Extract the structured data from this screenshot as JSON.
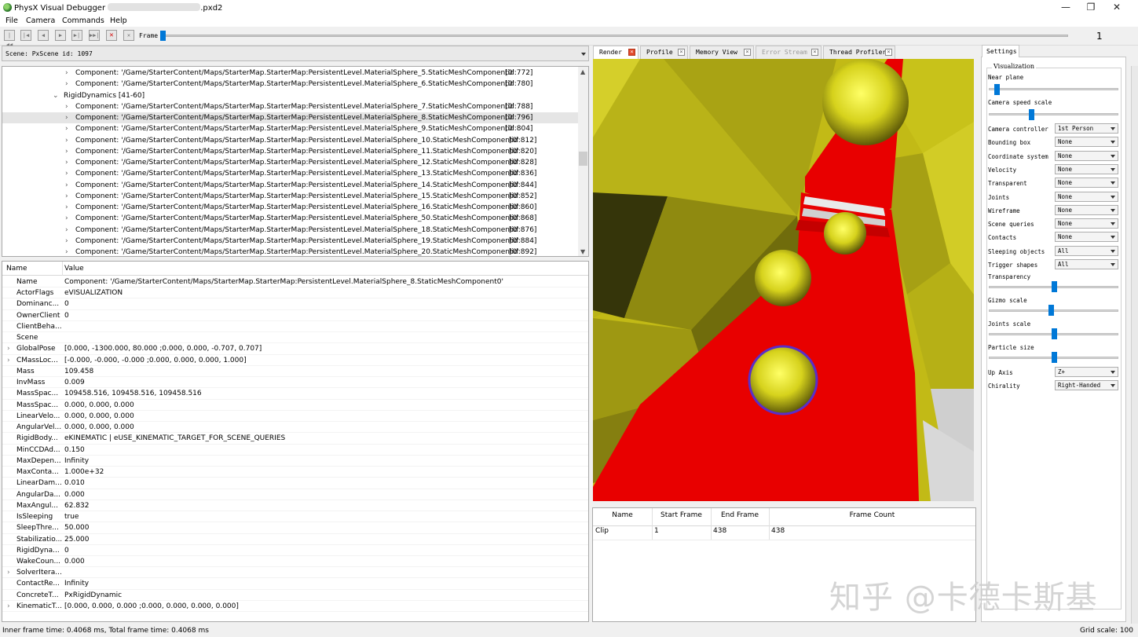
{
  "window": {
    "title_prefix": "PhysX Visual Debugger",
    "title_suffix": ".pxd2",
    "minimize_icon": "minimize-icon",
    "maximize_icon": "maximize-icon",
    "close_icon": "close-icon"
  },
  "menu": [
    "File",
    "Camera",
    "Commands",
    "Help"
  ],
  "toolbar": {
    "buttons": [
      "go-to-first-frame-icon",
      "step-back-icon",
      "play-backward-icon",
      "play-forward-icon",
      "step-forward-icon",
      "go-to-last-frame-icon",
      "stop-icon",
      "disconnect-icon"
    ],
    "frame_label": "Frame",
    "frame_value": "1"
  },
  "scene": {
    "label": "Scene: PxScene id: 1097"
  },
  "tree": {
    "group_label": "RigidDynamics [41-60]",
    "rows": [
      {
        "text": "Component: '/Game/StarterContent/Maps/StarterMap.StarterMap:PersistentLevel.MaterialSphere_5.StaticMeshComponent0'",
        "id": "[id:772]"
      },
      {
        "text": "Component: '/Game/StarterContent/Maps/StarterMap.StarterMap:PersistentLevel.MaterialSphere_6.StaticMeshComponent0'",
        "id": "[id:780]"
      },
      {
        "text": "Component: '/Game/StarterContent/Maps/StarterMap.StarterMap:PersistentLevel.MaterialSphere_7.StaticMeshComponent0'",
        "id": "[id:788]"
      },
      {
        "text": "Component: '/Game/StarterContent/Maps/StarterMap.StarterMap:PersistentLevel.MaterialSphere_8.StaticMeshComponent0'",
        "id": "[id:796]"
      },
      {
        "text": "Component: '/Game/StarterContent/Maps/StarterMap.StarterMap:PersistentLevel.MaterialSphere_9.StaticMeshComponent0'",
        "id": "[id:804]"
      },
      {
        "text": "Component: '/Game/StarterContent/Maps/StarterMap.StarterMap:PersistentLevel.MaterialSphere_10.StaticMeshComponent0'",
        "id": "[id:812]"
      },
      {
        "text": "Component: '/Game/StarterContent/Maps/StarterMap.StarterMap:PersistentLevel.MaterialSphere_11.StaticMeshComponent0'",
        "id": "[id:820]"
      },
      {
        "text": "Component: '/Game/StarterContent/Maps/StarterMap.StarterMap:PersistentLevel.MaterialSphere_12.StaticMeshComponent0'",
        "id": "[id:828]"
      },
      {
        "text": "Component: '/Game/StarterContent/Maps/StarterMap.StarterMap:PersistentLevel.MaterialSphere_13.StaticMeshComponent0'",
        "id": "[id:836]"
      },
      {
        "text": "Component: '/Game/StarterContent/Maps/StarterMap.StarterMap:PersistentLevel.MaterialSphere_14.StaticMeshComponent0'",
        "id": "[id:844]"
      },
      {
        "text": "Component: '/Game/StarterContent/Maps/StarterMap.StarterMap:PersistentLevel.MaterialSphere_15.StaticMeshComponent0'",
        "id": "[id:852]"
      },
      {
        "text": "Component: '/Game/StarterContent/Maps/StarterMap.StarterMap:PersistentLevel.MaterialSphere_16.StaticMeshComponent0'",
        "id": "[id:860]"
      },
      {
        "text": "Component: '/Game/StarterContent/Maps/StarterMap.StarterMap:PersistentLevel.MaterialSphere_50.StaticMeshComponent0'",
        "id": "[id:868]"
      },
      {
        "text": "Component: '/Game/StarterContent/Maps/StarterMap.StarterMap:PersistentLevel.MaterialSphere_18.StaticMeshComponent0'",
        "id": "[id:876]"
      },
      {
        "text": "Component: '/Game/StarterContent/Maps/StarterMap.StarterMap:PersistentLevel.MaterialSphere_19.StaticMeshComponent0'",
        "id": "[id:884]"
      },
      {
        "text": "Component: '/Game/StarterContent/Maps/StarterMap.StarterMap:PersistentLevel.MaterialSphere_20.StaticMeshComponent0'",
        "id": "[id:892]"
      }
    ]
  },
  "properties": {
    "header_name": "Name",
    "header_value": "Value",
    "rows": [
      {
        "name": "Name",
        "value": "Component: '/Game/StarterContent/Maps/StarterMap.StarterMap:PersistentLevel.MaterialSphere_8.StaticMeshComponent0'",
        "expandable": false
      },
      {
        "name": "ActorFlags",
        "value": "eVISUALIZATION",
        "expandable": false
      },
      {
        "name": "Dominanc...",
        "value": "0",
        "expandable": false
      },
      {
        "name": "OwnerClient",
        "value": "0",
        "expandable": false
      },
      {
        "name": "ClientBeha...",
        "value": "",
        "expandable": false
      },
      {
        "name": "Scene",
        "value": "",
        "expandable": false
      },
      {
        "name": "GlobalPose",
        "value": "[0.000, -1300.000, 80.000 ;0.000, 0.000, -0.707, 0.707]",
        "expandable": true
      },
      {
        "name": "CMassLoc...",
        "value": "[-0.000, -0.000, -0.000 ;0.000, 0.000, 0.000, 1.000]",
        "expandable": true
      },
      {
        "name": "Mass",
        "value": "109.458",
        "expandable": false
      },
      {
        "name": "InvMass",
        "value": "0.009",
        "expandable": false
      },
      {
        "name": "MassSpac...",
        "value": "109458.516, 109458.516, 109458.516",
        "expandable": false
      },
      {
        "name": "MassSpac...",
        "value": "0.000, 0.000, 0.000",
        "expandable": false
      },
      {
        "name": "LinearVelo...",
        "value": "0.000, 0.000, 0.000",
        "expandable": false
      },
      {
        "name": "AngularVel...",
        "value": "0.000, 0.000, 0.000",
        "expandable": false
      },
      {
        "name": "RigidBody...",
        "value": "eKINEMATIC | eUSE_KINEMATIC_TARGET_FOR_SCENE_QUERIES",
        "expandable": false
      },
      {
        "name": "MinCCDAd...",
        "value": "0.150",
        "expandable": false
      },
      {
        "name": "MaxDepen...",
        "value": "Infinity",
        "expandable": false
      },
      {
        "name": "MaxConta...",
        "value": "1.000e+32",
        "expandable": false
      },
      {
        "name": "LinearDam...",
        "value": "0.010",
        "expandable": false
      },
      {
        "name": "AngularDa...",
        "value": "0.000",
        "expandable": false
      },
      {
        "name": "MaxAngul...",
        "value": "62.832",
        "expandable": false
      },
      {
        "name": "IsSleeping",
        "value": "true",
        "expandable": false
      },
      {
        "name": "SleepThre...",
        "value": "50.000",
        "expandable": false
      },
      {
        "name": "Stabilizatio...",
        "value": "25.000",
        "expandable": false
      },
      {
        "name": "RigidDyna...",
        "value": "0",
        "expandable": false
      },
      {
        "name": "WakeCoun...",
        "value": "0.000",
        "expandable": false
      },
      {
        "name": "SolverItera...",
        "value": "",
        "expandable": true
      },
      {
        "name": "ContactRe...",
        "value": "Infinity",
        "expandable": false
      },
      {
        "name": "ConcreteT...",
        "value": "PxRigidDynamic",
        "expandable": false
      },
      {
        "name": "KinematicT...",
        "value": "[0.000, 0.000, 0.000 ;0.000, 0.000, 0.000, 0.000]",
        "expandable": true
      }
    ]
  },
  "status": {
    "left": "Inner frame time: 0.4068 ms, Total frame time: 0.4068 ms",
    "right": "Grid scale: 100"
  },
  "tabs": [
    {
      "label": "Render",
      "active": true,
      "disabled": false
    },
    {
      "label": "Profile",
      "active": false,
      "disabled": false
    },
    {
      "label": "Memory View",
      "active": false,
      "disabled": false
    },
    {
      "label": "Error Stream",
      "active": false,
      "disabled": true
    },
    {
      "label": "Thread Profiler",
      "active": false,
      "disabled": false
    }
  ],
  "clips": {
    "headers": [
      "Name",
      "Start Frame",
      "End Frame",
      "Frame Count"
    ],
    "rows": [
      [
        "Clip",
        "1",
        "438",
        "438"
      ]
    ]
  },
  "settings": {
    "tab_label": "Settings",
    "group_label": "Visualization",
    "near_plane_label": "Near plane",
    "camera_speed_label": "Camera speed scale",
    "dropdowns": [
      {
        "label": "Camera controller",
        "value": "1st Person"
      },
      {
        "label": "Bounding box",
        "value": "None"
      },
      {
        "label": "Coordinate system",
        "value": "None"
      },
      {
        "label": "Velocity",
        "value": "None"
      },
      {
        "label": "Transparent",
        "value": "None"
      },
      {
        "label": "Joints",
        "value": "None"
      },
      {
        "label": "Wireframe",
        "value": "None"
      },
      {
        "label": "Scene queries",
        "value": "None"
      },
      {
        "label": "Contacts",
        "value": "None"
      },
      {
        "label": "Sleeping objects",
        "value": "All"
      },
      {
        "label": "Trigger shapes",
        "value": "All"
      }
    ],
    "sliders": [
      {
        "label": "Transparency",
        "level": 0.5
      },
      {
        "label": "Gizmo scale",
        "level": 0.48
      },
      {
        "label": "Joints scale",
        "level": 0.5
      },
      {
        "label": "Particle size",
        "level": 0.5
      }
    ],
    "near_plane_level": 0.06,
    "camera_speed_level": 0.33,
    "up_axis_label": "Up Axis",
    "up_axis_value": "Z+",
    "chirality_label": "Chirality",
    "chirality_value": "Right-Handed"
  },
  "watermark": "知乎 @卡德卡斯基",
  "colors": {
    "accent": "#0078d7",
    "viewport_yellow": "#c9c21a",
    "viewport_red": "#e80000"
  }
}
